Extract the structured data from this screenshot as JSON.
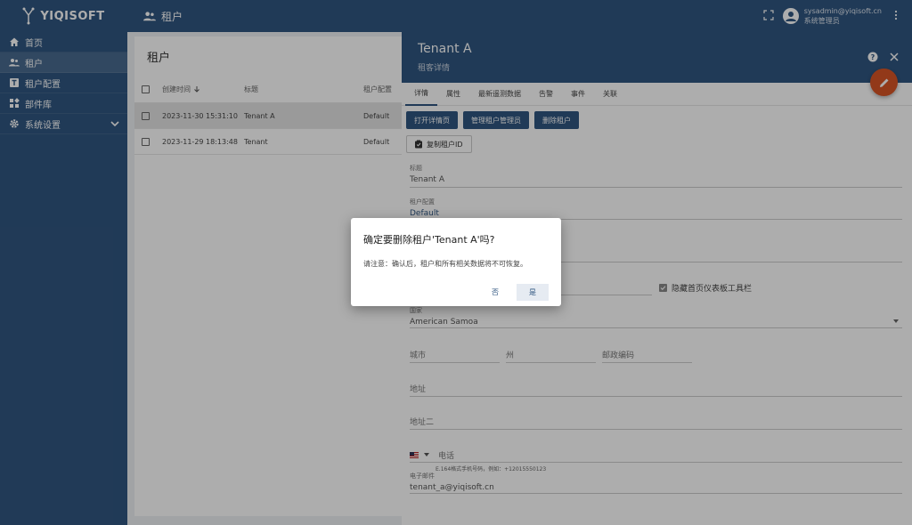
{
  "app": {
    "logo_text": "YIQISOFT",
    "breadcrumb": "租户",
    "user_email": "sysadmin@yiqisoft.cn",
    "user_role": "系统管理员"
  },
  "sidebar": {
    "items": [
      {
        "label": "首页",
        "icon": "home-icon"
      },
      {
        "label": "租户",
        "icon": "people-icon"
      },
      {
        "label": "租户配置",
        "icon": "tenant-profile-icon"
      },
      {
        "label": "部件库",
        "icon": "widgets-icon"
      },
      {
        "label": "系统设置",
        "icon": "gear-icon"
      }
    ]
  },
  "list": {
    "title": "租户",
    "columns": [
      "创建时间",
      "标题",
      "租户配置"
    ],
    "rows": [
      {
        "time": "2023-11-30 15:31:10",
        "title": "Tenant A",
        "profile": "Default"
      },
      {
        "time": "2023-11-29 18:13:48",
        "title": "Tenant",
        "profile": "Default"
      }
    ]
  },
  "details": {
    "title": "Tenant A",
    "subtitle": "租客详情",
    "tabs": [
      "详情",
      "属性",
      "最新遥测数据",
      "告警",
      "事件",
      "关联"
    ],
    "buttons": {
      "open": "打开详情页",
      "manage_admins": "管理租户管理员",
      "delete": "删除租户",
      "copy_id": "复制租户ID"
    },
    "fields": {
      "title_label": "标题",
      "title_value": "Tenant A",
      "profile_label": "租户配置",
      "profile_value": "Default",
      "hide_toolbar": "隐藏首页仪表板工具栏",
      "country_label": "国家",
      "country_value": "American Samoa",
      "city": "城市",
      "state": "州",
      "zip": "邮政编码",
      "address": "地址",
      "address2": "地址二",
      "phone": "电话",
      "phone_hint": "E.164格式手机号码，例如：+12015550123",
      "email_label": "电子邮件",
      "email_value": "tenant_a@yiqisoft.cn"
    }
  },
  "dialog": {
    "title": "确定要删除租户'Tenant A'吗?",
    "body": "请注意：确认后，租户和所有相关数据将不可恢复。",
    "no": "否",
    "yes": "是"
  },
  "colors": {
    "primary": "#305680",
    "fab": "#d75526"
  }
}
